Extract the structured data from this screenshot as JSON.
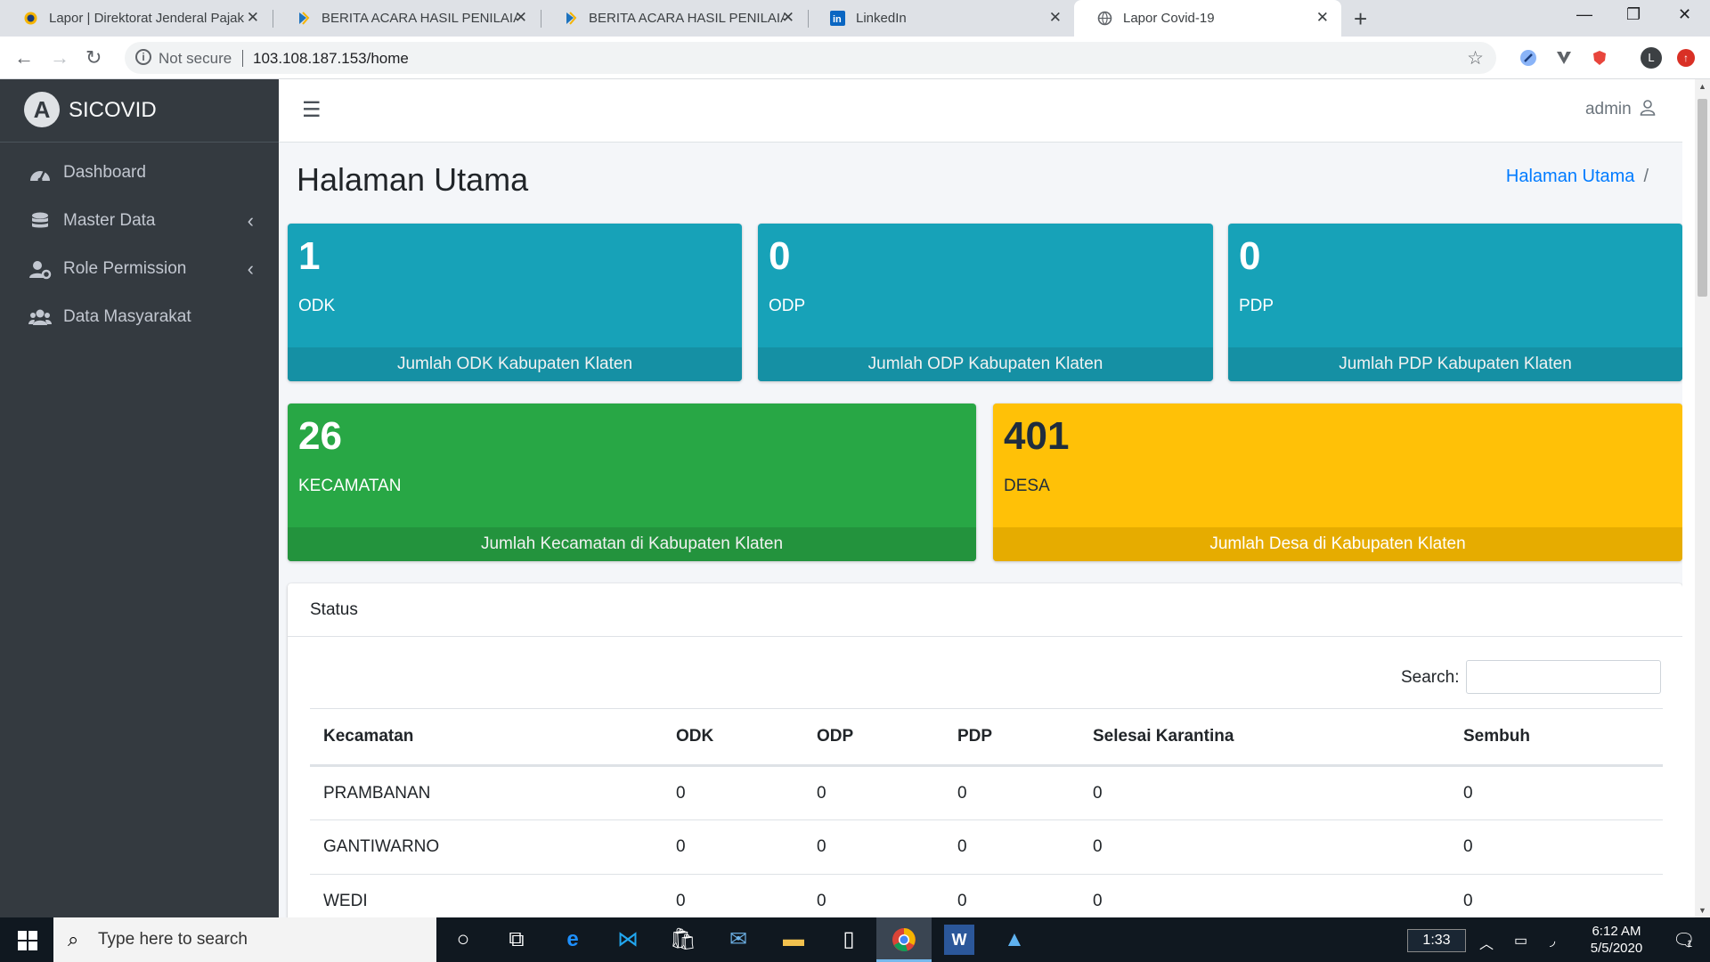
{
  "browser": {
    "tabs": [
      {
        "title": "Lapor | Direktorat Jenderal Pajak",
        "active": false
      },
      {
        "title": "BERITA ACARA HASIL PENILAIA P",
        "active": false
      },
      {
        "title": "BERITA ACARA HASIL PENILAIA P",
        "active": false
      },
      {
        "title": "LinkedIn",
        "active": false
      },
      {
        "title": "Lapor Covid-19",
        "active": true
      }
    ],
    "security_text": "Not secure",
    "url": "103.108.187.153/home",
    "profile_initial": "L"
  },
  "sidebar": {
    "brand": "SICOVID",
    "items": [
      {
        "label": "Dashboard",
        "icon": "dashboard-icon",
        "has_submenu": false
      },
      {
        "label": "Master Data",
        "icon": "database-icon",
        "has_submenu": true
      },
      {
        "label": "Role Permission",
        "icon": "users-cog-icon",
        "has_submenu": true
      },
      {
        "label": "Data Masyarakat",
        "icon": "users-icon",
        "has_submenu": false
      }
    ]
  },
  "header": {
    "user": "admin"
  },
  "page": {
    "title": "Halaman Utama",
    "breadcrumb": "Halaman Utama"
  },
  "stats": [
    {
      "value": "1",
      "label": "ODK",
      "footer": "Jumlah ODK Kabupaten Klaten",
      "color": "#17a2b8"
    },
    {
      "value": "0",
      "label": "ODP",
      "footer": "Jumlah ODP Kabupaten Klaten",
      "color": "#17a2b8"
    },
    {
      "value": "0",
      "label": "PDP",
      "footer": "Jumlah PDP Kabupaten Klaten",
      "color": "#17a2b8"
    },
    {
      "value": "26",
      "label": "KECAMATAN",
      "footer": "Jumlah Kecamatan di Kabupaten Klaten",
      "color": "#28a745"
    },
    {
      "value": "401",
      "label": "DESA",
      "footer": "Jumlah Desa di Kabupaten Klaten",
      "color": "#ffc107"
    }
  ],
  "status_card": {
    "title": "Status",
    "search_label": "Search:",
    "search_value": "",
    "columns": [
      "Kecamatan",
      "ODK",
      "ODP",
      "PDP",
      "Selesai Karantina",
      "Sembuh"
    ],
    "rows": [
      [
        "PRAMBANAN",
        "0",
        "0",
        "0",
        "0",
        "0"
      ],
      [
        "GANTIWARNO",
        "0",
        "0",
        "0",
        "0",
        "0"
      ],
      [
        "WEDI",
        "0",
        "0",
        "0",
        "0",
        "0"
      ]
    ]
  },
  "taskbar": {
    "search_placeholder": "Type here to search",
    "tray_box": "1:33",
    "time": "6:12 AM",
    "date": "5/5/2020",
    "notification_count": "1"
  }
}
